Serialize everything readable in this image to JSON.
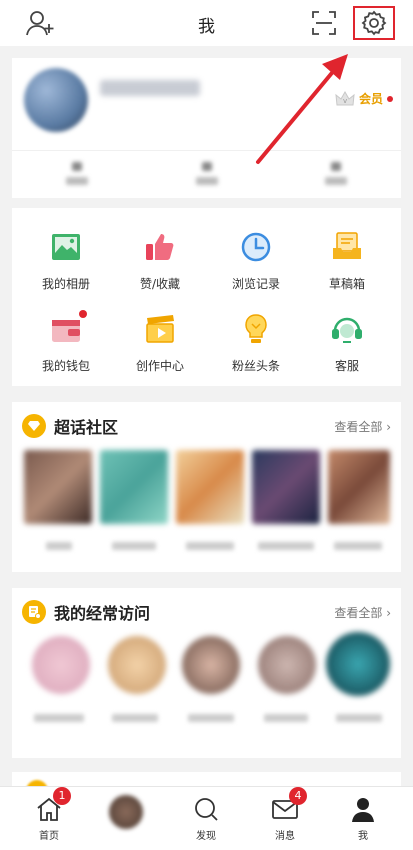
{
  "header": {
    "title": "我"
  },
  "profile": {
    "vip_label": "会员"
  },
  "tools": [
    {
      "label": "我的相册",
      "icon": "album-icon"
    },
    {
      "label": "赞/收藏",
      "icon": "thumb-up-icon"
    },
    {
      "label": "浏览记录",
      "icon": "history-clock-icon"
    },
    {
      "label": "草稿箱",
      "icon": "drafts-inbox-icon"
    },
    {
      "label": "我的钱包",
      "icon": "wallet-icon"
    },
    {
      "label": "创作中心",
      "icon": "creator-clapper-icon"
    },
    {
      "label": "粉丝头条",
      "icon": "fans-bulb-icon"
    },
    {
      "label": "客服",
      "icon": "headset-icon"
    }
  ],
  "super_topics": {
    "title": "超话社区",
    "see_all": "查看全部"
  },
  "frequent": {
    "title": "我的经常访问",
    "see_all": "查看全部"
  },
  "tabbar": {
    "home": {
      "label": "首页",
      "badge": "1"
    },
    "discover": {
      "label": "发现"
    },
    "messages": {
      "label": "消息",
      "badge": "4"
    },
    "me": {
      "label": "我"
    }
  },
  "colors": {
    "accent": "#e0252e",
    "gold": "#f6b400",
    "vip_text": "#e89f00"
  }
}
